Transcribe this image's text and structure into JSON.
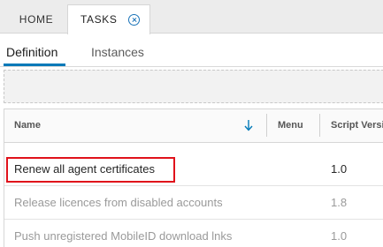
{
  "tabs": {
    "home_label": "HOME",
    "tasks_label": "TASKS"
  },
  "subtabs": {
    "definition_label": "Definition",
    "instances_label": "Instances"
  },
  "grid": {
    "columns": {
      "name": "Name",
      "menu": "Menu",
      "script_version": "Script Versi"
    },
    "rows": [
      {
        "name": "Renew all agent certificates",
        "menu": "",
        "version": "1.0",
        "state": "enabled"
      },
      {
        "name": "Release licences from disabled accounts",
        "menu": "",
        "version": "1.8",
        "state": "disabled"
      },
      {
        "name": "Push unregistered MobileID download lnks",
        "menu": "",
        "version": "1.0",
        "state": "disabled"
      }
    ]
  },
  "colors": {
    "accent": "#0079b8",
    "highlight": "#e0121b",
    "disabled_text": "#9a9a9a"
  }
}
